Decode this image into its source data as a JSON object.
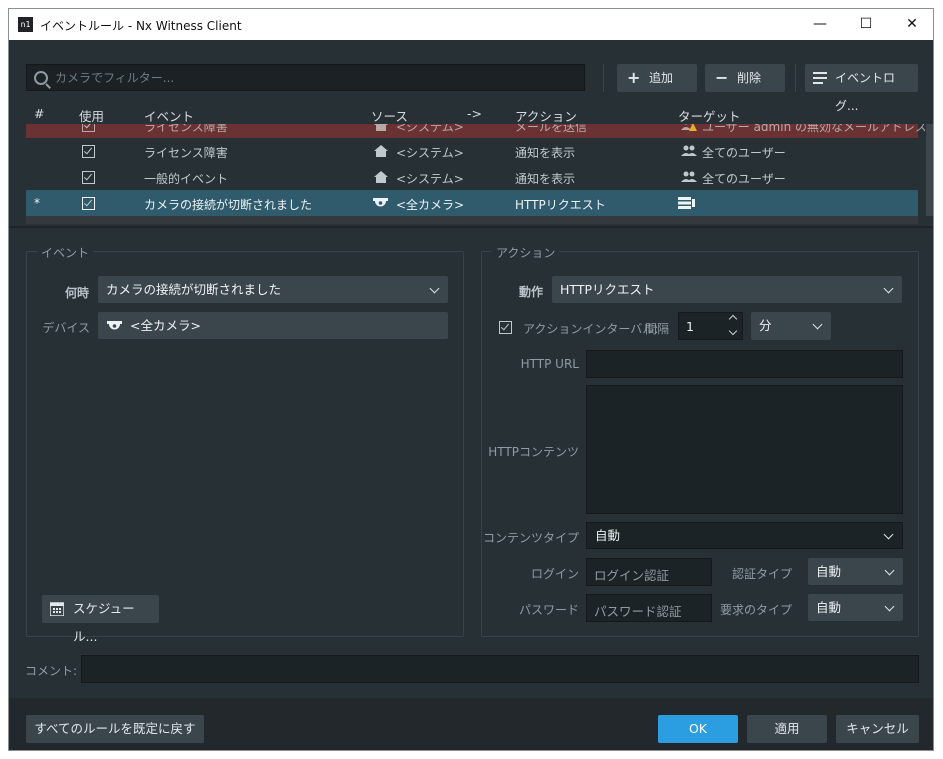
{
  "window": {
    "app_icon": "n1",
    "title": "イベントルール - Nx Witness Client",
    "minimize_glyph": "—",
    "maximize_glyph": "☐",
    "close_glyph": "✕"
  },
  "toolbar": {
    "search_placeholder": "カメラでフィルター...",
    "add_label": "追加",
    "delete_label": "削除",
    "event_log_label": "イベントログ..."
  },
  "table": {
    "headers": {
      "num": "#",
      "enabled": "使用",
      "event": "イベント",
      "source": "ソース",
      "arrow": "->",
      "action": "アクション",
      "target": "ターゲット"
    },
    "rows": [
      {
        "num": "",
        "event": "ライセンス障害",
        "source": "<システム>",
        "action": "メールを送信",
        "target": "ユーザー admin の無効なメールアドレス"
      },
      {
        "num": "",
        "event": "ライセンス障害",
        "source": "<システム>",
        "action": "通知を表示",
        "target": "全てのユーザー"
      },
      {
        "num": "",
        "event": "一般的イベント",
        "source": "<システム>",
        "action": "通知を表示",
        "target": "全てのユーザー"
      },
      {
        "num": "*",
        "event": "カメラの接続が切断されました",
        "source": "<全カメラ>",
        "action": "HTTPリクエスト",
        "target": ""
      }
    ]
  },
  "event_panel": {
    "title": "イベント",
    "when_label": "何時",
    "when_value": "カメラの接続が切断されました",
    "device_label": "デバイス",
    "device_value": "<全カメラ>",
    "schedule_label": "スケジュール..."
  },
  "action_panel": {
    "title": "アクション",
    "action_label": "動作",
    "action_value": "HTTPリクエスト",
    "interval_label": "アクションインターバル:",
    "interval_sub": "間隔",
    "interval_value": "1",
    "interval_unit": "分",
    "url_label": "HTTP URL",
    "content_label": "HTTPコンテンツ",
    "content_type_label": "コンテンツタイプ",
    "content_type_value": "自動",
    "login_label": "ログイン",
    "login_placeholder": "ログイン認証",
    "auth_type_label": "認証タイプ",
    "auth_type_value": "自動",
    "password_label": "パスワード",
    "password_placeholder": "パスワード認証",
    "request_type_label": "要求のタイプ",
    "request_type_value": "自動"
  },
  "comment_label": "コメント:",
  "footer": {
    "reset_label": "すべてのルールを既定に戻す",
    "ok_label": "OK",
    "apply_label": "適用",
    "cancel_label": "キャンセル"
  }
}
